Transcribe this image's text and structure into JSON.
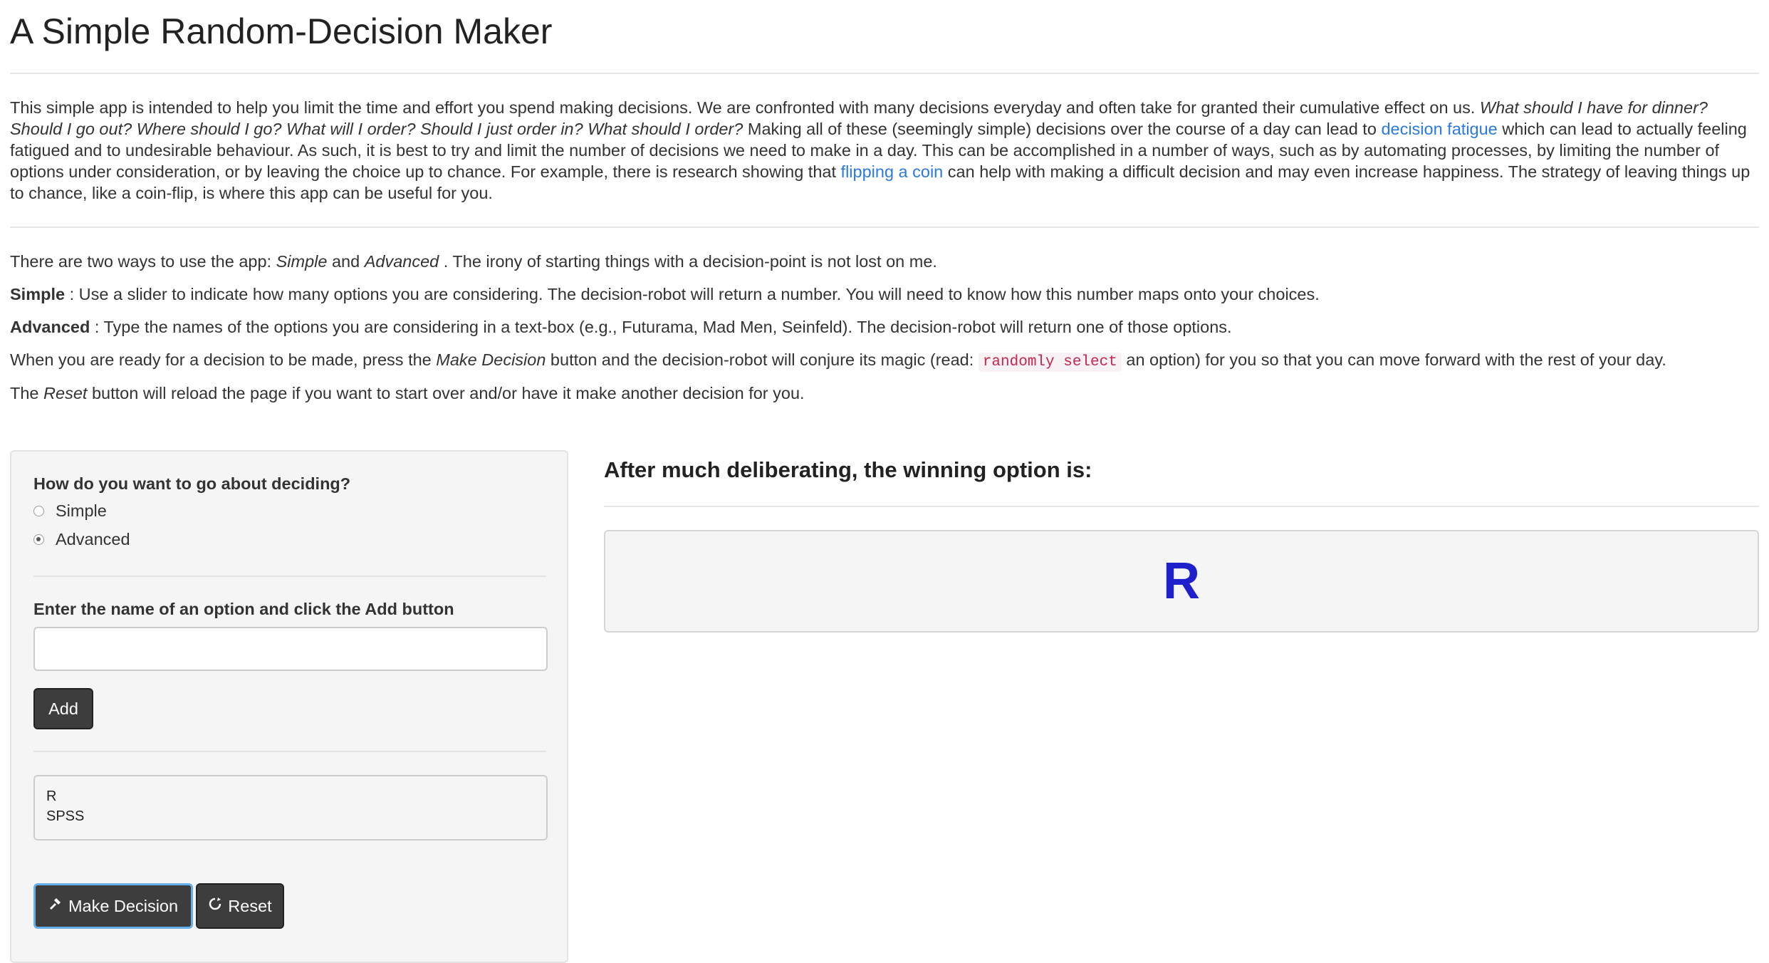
{
  "page": {
    "title": "A Simple Random-Decision Maker"
  },
  "intro": {
    "text1": "This simple app is intended to help you limit the time and effort you spend making decisions. We are confronted with many decisions everyday and often take for granted their cumulative effect on us. ",
    "italic_questions": "What should I have for dinner? Should I go out? Where should I go? What will I order? Should I just order in? What should I order?",
    "text2": " Making all of these (seemingly simple) decisions over the course of a day can lead to ",
    "link_fatigue": "decision fatigue",
    "text3": " which can lead to actually feeling fatigued and to undesirable behaviour. As such, it is best to try and limit the number of decisions we need to make in a day. This can be accomplished in a number of ways, such as by automating processes, by limiting the number of options under consideration, or by leaving the choice up to chance. For example, there is research showing that ",
    "link_coin": "flipping a coin",
    "text4": " can help with making a difficult decision and may even increase happiness. The strategy of leaving things up to chance, like a coin-flip, is where this app can be useful for you."
  },
  "usage": {
    "line1_a": "There are two ways to use the app: ",
    "line1_simple": "Simple",
    "line1_and": " and ",
    "line1_advanced": "Advanced",
    "line1_b": " . The irony of starting things with a decision-point is not lost on me.",
    "simple_label": "Simple",
    "simple_text": " : Use a slider to indicate how many options you are considering. The decision-robot will return a number. You will need to know how this number maps onto your choices.",
    "advanced_label": "Advanced",
    "advanced_text": " : Type the names of the options you are considering in a text-box (e.g., Futurama, Mad Men, Seinfeld). The decision-robot will return one of those options.",
    "ready_a": "When you are ready for a decision to be made, press the ",
    "ready_italic": "Make Decision",
    "ready_b": " button and the decision-robot will conjure its magic (read: ",
    "ready_code": "randomly select",
    "ready_c": " an option) for you so that you can move forward with the rest of your day.",
    "reset_a": "The ",
    "reset_italic": "Reset",
    "reset_b": " button will reload the page if you want to start over and/or have it make another decision for you."
  },
  "sidebar": {
    "mode_question": "How do you want to go about deciding?",
    "mode_options": [
      "Simple",
      "Advanced"
    ],
    "selected_mode": "Advanced",
    "option_prompt": "Enter the name of an option and click the Add button",
    "option_input_value": "",
    "add_label": "Add",
    "options_list": [
      "R",
      "SPSS"
    ],
    "make_decision_label": "Make Decision",
    "reset_label": "Reset"
  },
  "result": {
    "heading": "After much deliberating, the winning option is:",
    "value": "R"
  },
  "colors": {
    "link": "#2a7ae2",
    "result": "#1f1fcc",
    "button": "#3d3d3d",
    "code": "#c7254e"
  },
  "icons": {
    "make_decision": "gavel-icon",
    "reset": "refresh-icon"
  }
}
